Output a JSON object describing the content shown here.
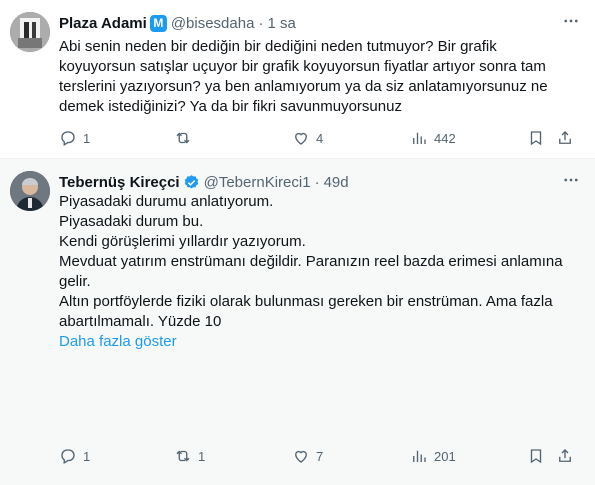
{
  "tweet1": {
    "name": "Plaza Adami",
    "badge": "M",
    "handle": "@bisesdaha",
    "separator": "·",
    "time": "1 sa",
    "lines": [
      "Abi senin neden bir dediğin bir dediğini neden tutmuyor? Bir grafik",
      "koyuyorsun satışlar uçuyor bir grafik koyuyorsun fiyatlar artıyor sonra tam",
      "terslerini yazıyorsun? ya ben anlamıyorum ya da siz anlatamıyorsunuz ne",
      "demek istediğinizi? Ya da bir fikri savunmuyorsunuz"
    ],
    "actions": {
      "replies": "1",
      "reposts": "",
      "likes": "4",
      "views": "442"
    }
  },
  "tweet2": {
    "name": "Tebernüş Kireçci",
    "handle": "@TebernKireci1",
    "separator": "·",
    "time": "49d",
    "paragraphs": [
      [
        "Piyasadaki durumu anlatıyorum."
      ],
      [
        "Piyasadaki durum bu."
      ],
      [
        "Kendi görüşlerimi yıllardır yazıyorum."
      ],
      [
        "Mevduat yatırım enstrümanı değildir. Paranızın reel bazda erimesi anlamına",
        "gelir."
      ],
      [
        "Altın portföylerde fiziki olarak bulunması gereken bir enstrüman. Ama fazla",
        "abartılmamalı. Yüzde 10"
      ]
    ],
    "show_more": "Daha fazla göster",
    "actions": {
      "replies": "1",
      "reposts": "1",
      "likes": "7",
      "views": "201"
    }
  },
  "colors": {
    "accent": "#1d9bf0",
    "text": "#0f1419",
    "muted": "#536471",
    "reply_bg": "#f7f9f9"
  },
  "icons": [
    "more-icon",
    "reply-icon",
    "repost-icon",
    "like-icon",
    "views-icon",
    "bookmark-icon",
    "share-icon",
    "verified-icon"
  ]
}
